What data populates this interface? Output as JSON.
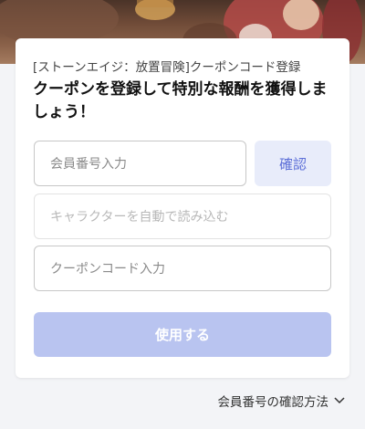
{
  "banner": {
    "icon": "game-artwork"
  },
  "card": {
    "subtitle": "[ストーンエイジ：放置冒険]クーポンコード登録",
    "title": "クーポンを登録して特別な報酬を獲得しましょう！"
  },
  "form": {
    "member_id_placeholder": "会員番号入力",
    "confirm_label": "確認",
    "character_placeholder": "キャラクターを自動で読み込む",
    "coupon_placeholder": "クーポンコード入力",
    "use_label": "使用する"
  },
  "help": {
    "label": "会員番号の確認方法",
    "icon": "chevron-down-icon"
  },
  "colors": {
    "accent": "#5d6fd8",
    "use_button_bg": "#b9c4f0",
    "confirm_button_bg": "#e8ecfa"
  }
}
